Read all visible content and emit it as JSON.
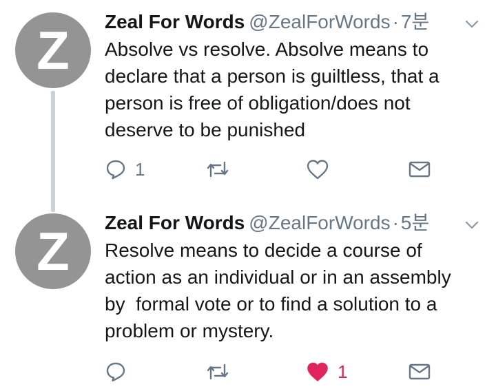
{
  "tweets": [
    {
      "avatar_letter": "Z",
      "name": "Zeal For Words",
      "handle": "@ZealForWords",
      "separator": "·",
      "time": "7분",
      "text": "Absolve vs resolve. Absolve means to\ndeclare that a person is guiltless, that a\nperson is free of obligation/does not\ndeserve to be punished",
      "reply_count": "1",
      "retweet_count": "",
      "like_count": "",
      "liked": false
    },
    {
      "avatar_letter": "Z",
      "name": "Zeal For Words",
      "handle": "@ZealForWords",
      "separator": "·",
      "time": "5분",
      "text": "Resolve means to decide a course of\naction as an individual or in an assembly\nby  formal vote or to find a solution to a\nproblem or mystery.",
      "reply_count": "",
      "retweet_count": "",
      "like_count": "1",
      "liked": true
    }
  ],
  "icons": {
    "reply": "reply-icon",
    "retweet": "retweet-icon",
    "like": "heart-icon",
    "dm": "envelope-icon",
    "menu": "chevron-down-icon"
  },
  "colors": {
    "avatar_bg": "#949494",
    "text": "#14171a",
    "muted": "#657786",
    "like_active": "#e0245e",
    "thread_line": "#c9d2db"
  }
}
